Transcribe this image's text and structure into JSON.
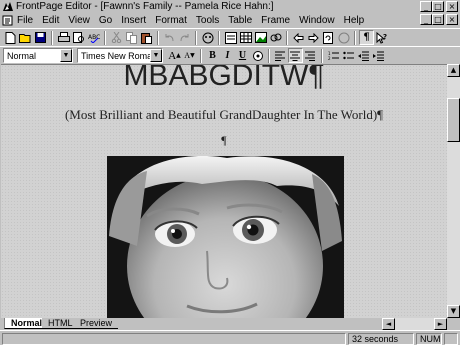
{
  "window": {
    "title": "FrontPage Editor - [Fawnn's Family -- Pamela Rice Hahn:]",
    "buttons": [
      "_",
      "□",
      "×"
    ]
  },
  "menubar": {
    "items": [
      {
        "label": "File"
      },
      {
        "label": "Edit"
      },
      {
        "label": "View"
      },
      {
        "label": "Go"
      },
      {
        "label": "Insert"
      },
      {
        "label": "Format"
      },
      {
        "label": "Tools"
      },
      {
        "label": "Table"
      },
      {
        "label": "Frame"
      },
      {
        "label": "Window"
      },
      {
        "label": "Help"
      }
    ],
    "doc_buttons": [
      "_",
      "□",
      "×"
    ]
  },
  "format_toolbar": {
    "style_value": "Normal",
    "font_value": "Times New Roman",
    "increase_font": "A",
    "decrease_font": "A",
    "bold": "B",
    "italic": "I",
    "underline": "U"
  },
  "document": {
    "heading": "MBABGDITW¶",
    "subtitle": "(Most Brilliant and Beautiful GrandDaughter In The World)¶",
    "empty_paragraph": "¶"
  },
  "tabs": [
    {
      "label": "Normal",
      "active": true
    },
    {
      "label": "HTML",
      "active": false
    },
    {
      "label": "Preview",
      "active": false
    }
  ],
  "statusbar": {
    "download_time": "32 seconds",
    "num_lock": "NUM"
  },
  "colors": {
    "chrome": "#c0c0c0",
    "document_background": "#d2d2d2"
  }
}
